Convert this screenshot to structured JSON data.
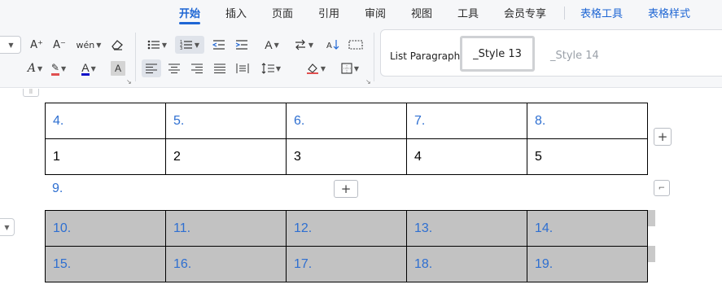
{
  "ribbon": {
    "tabs": [
      {
        "label": "开始",
        "active": true
      },
      {
        "label": "插入"
      },
      {
        "label": "页面"
      },
      {
        "label": "引用"
      },
      {
        "label": "审阅"
      },
      {
        "label": "视图"
      },
      {
        "label": "工具"
      },
      {
        "label": "会员专享"
      }
    ],
    "context_tabs": [
      {
        "label": "表格工具"
      },
      {
        "label": "表格样式"
      }
    ]
  },
  "toolbar": {
    "font": {
      "increase_size_glyph": "A⁺",
      "decrease_size_glyph": "A⁻",
      "phonetic_glyph": "wén",
      "clear_format_icon": "eraser-icon",
      "text_effect_glyph": "A",
      "highlight_glyph": "✎",
      "font_color_glyph": "A",
      "char_shading_glyph": "A"
    },
    "paragraph": {
      "bullets_icon": "bullet-list-icon",
      "numbering_icon": "numbered-list-icon",
      "decrease_indent_icon": "outdent-icon",
      "increase_indent_icon": "indent-icon",
      "char_scale_glyph": "A",
      "text_direction_icon": "text-direction-icon",
      "sort_icon": "sort-icon",
      "show_marks_icon": "paragraph-marks-icon",
      "align_left_icon": "align-left-icon",
      "align_center_icon": "align-center-icon",
      "align_right_icon": "align-right-icon",
      "justify_icon": "justify-icon",
      "distribute_icon": "distribute-icon",
      "line_spacing_icon": "line-spacing-icon",
      "shading_icon": "shading-icon",
      "borders_icon": "borders-icon"
    },
    "styles": {
      "items": [
        "List Paragraph",
        "_Style 13",
        "_Style 14"
      ],
      "selected": "_Style 13"
    }
  },
  "document": {
    "top_table": {
      "rows": [
        [
          "4.",
          "5.",
          "6.",
          "7.",
          "8."
        ],
        [
          "1",
          "2",
          "3",
          "4",
          "5"
        ]
      ]
    },
    "middle_paragraph": "9.",
    "bottom_table": {
      "rows": [
        [
          "10.",
          "11.",
          "12.",
          "13.",
          "14."
        ],
        [
          "15.",
          "16.",
          "17.",
          "18.",
          "19."
        ]
      ]
    },
    "add_column_glyph": "+",
    "add_row_glyph": "+",
    "resize_glyph": "⌐"
  },
  "colors": {
    "accent": "#1e66d4",
    "numbering_text": "#2e6fd1",
    "shaded_cell": "#c2c2c2"
  }
}
